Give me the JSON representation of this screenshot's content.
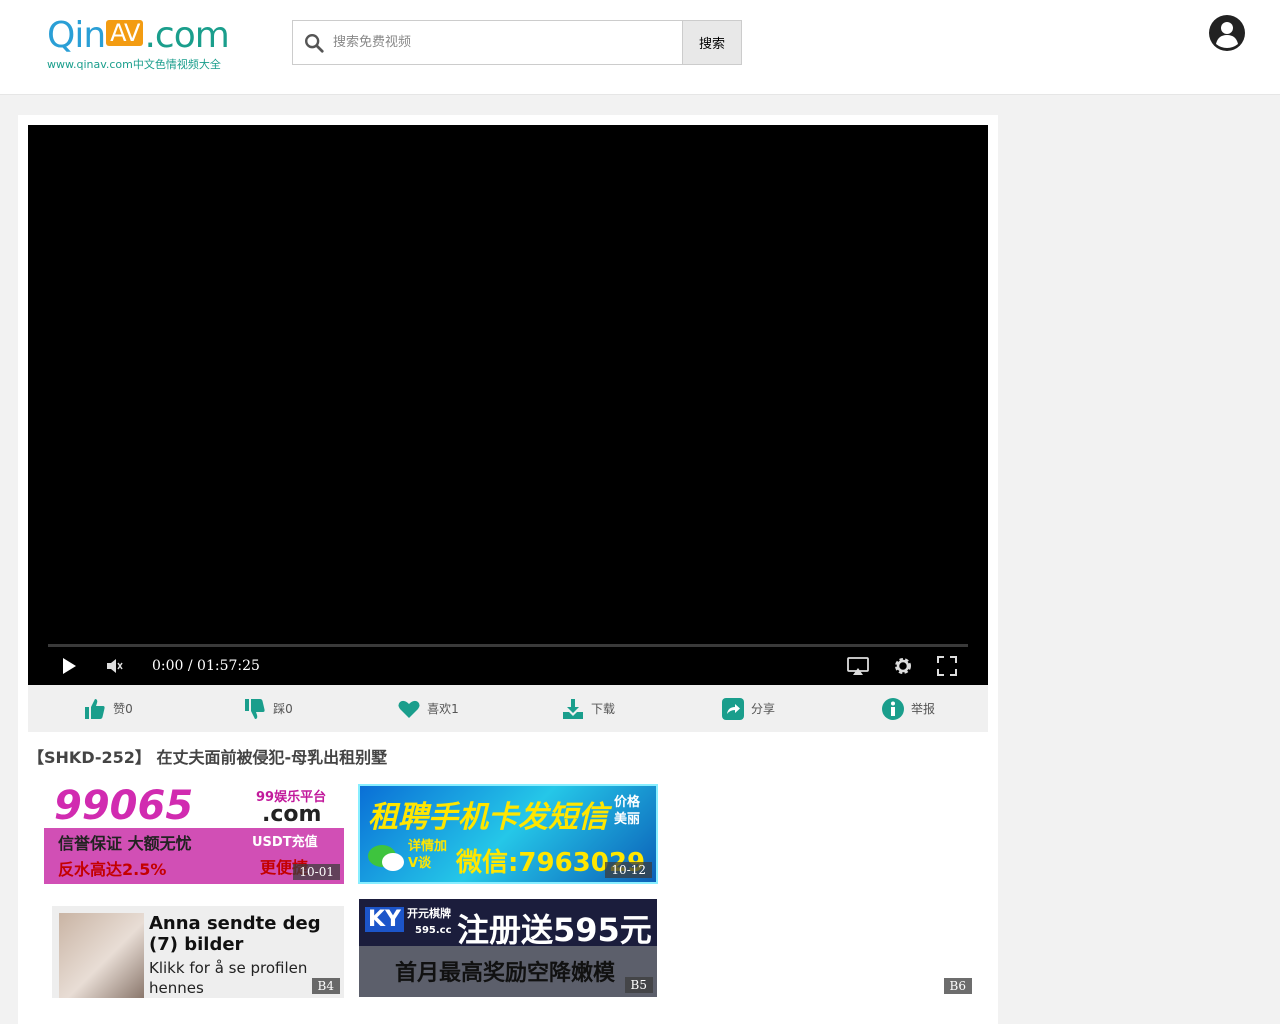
{
  "header": {
    "logo_main_prefix": "Qin",
    "logo_main_av": "AV",
    "logo_main_suffix": ".com",
    "logo_sub": "www.qinav.com中文色情视频大全",
    "search_placeholder": "搜索免费视频",
    "search_button": "搜索"
  },
  "player": {
    "time": "0:00 / 01:57:25"
  },
  "actions": [
    {
      "label": "赞0",
      "icon": "thumbs-up-icon"
    },
    {
      "label": "踩0",
      "icon": "thumbs-down-icon"
    },
    {
      "label": "喜欢1",
      "icon": "heart-icon"
    },
    {
      "label": "下载",
      "icon": "download-icon"
    },
    {
      "label": "分享",
      "icon": "share-icon"
    },
    {
      "label": "举报",
      "icon": "info-icon"
    }
  ],
  "video_title": "【SHKD-252】 在丈夫面前被侵犯-母乳出租别墅",
  "ads": {
    "ad1": {
      "line1": "99065",
      "badge": "99娱乐平台",
      "dotcom": ".com",
      "line2": "信誉保证 大额无忧",
      "line3": "反水高达2.5%",
      "side1": "USDT充值",
      "side2": "更便捷",
      "tag": "10-01"
    },
    "ad2": {
      "line1": "租聘手机卡发短信",
      "side": "价格美丽",
      "wx": "详情加V谈",
      "line2": "微信:7963029",
      "tag": "10-12"
    },
    "ad4": {
      "title": "Anna sendte deg (7) bilder",
      "text": "Klikk for å se profilen hennes",
      "tag": "B4"
    },
    "ad5": {
      "brand": "KY",
      "brand_sub": "开元棋牌",
      "domain": "595.cc",
      "line1": "注册送595元",
      "line2": "首月最高奖励空降嫩模",
      "tag": "B5"
    },
    "ad6": {
      "tag": "B6"
    }
  },
  "colors": {
    "accent": "#1a9e8c",
    "logo_blue": "#2a9fd6",
    "logo_orange": "#f39c12"
  }
}
